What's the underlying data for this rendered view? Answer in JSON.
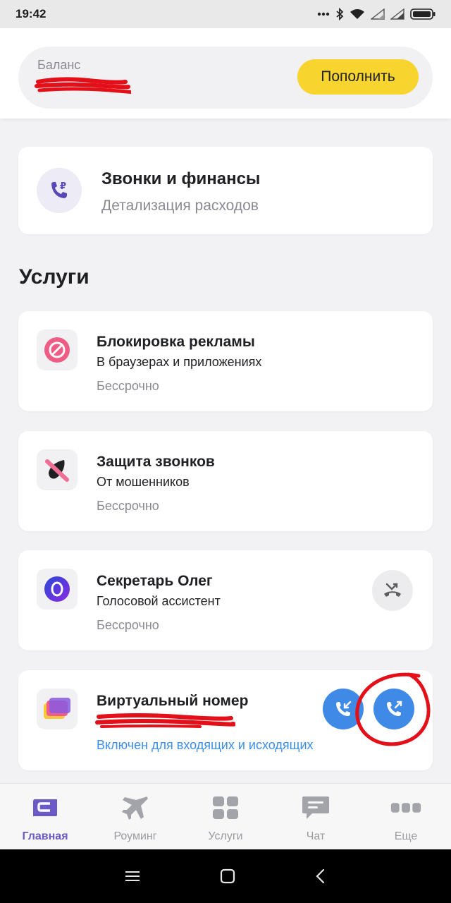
{
  "status_bar": {
    "time": "19:42",
    "icons": [
      "more-dots-icon",
      "bluetooth-icon",
      "wifi-icon",
      "signal-icon",
      "signal-icon",
      "battery-icon"
    ]
  },
  "balance": {
    "label": "Баланс",
    "value": "",
    "topup_label": "Пополнить"
  },
  "finance": {
    "title": "Звонки и финансы",
    "subtitle": "Детализация расходов",
    "icon": "phone-ruble-icon"
  },
  "services_section": {
    "title": "Услуги"
  },
  "services": [
    {
      "title": "Блокировка рекламы",
      "subtitle": "В браузерах и приложениях",
      "status": "Бессрочно",
      "icon": "no-ads-icon"
    },
    {
      "title": "Защита звонков",
      "subtitle": "От мошенников",
      "status": "Бессрочно",
      "icon": "call-protection-icon"
    },
    {
      "title": "Секретарь Олег",
      "subtitle": "Голосовой ассистент",
      "status": "Бессрочно",
      "icon": "oleg-assistant-icon"
    },
    {
      "title": "Виртуальный номер",
      "subtitle": "",
      "status": "Включен для входящих и исходящих",
      "icon": "virtual-number-icon"
    }
  ],
  "bottom_nav": [
    {
      "label": "Главная",
      "icon": "home-icon",
      "active": true
    },
    {
      "label": "Роуминг",
      "icon": "plane-icon",
      "active": false
    },
    {
      "label": "Услуги",
      "icon": "grid-icon",
      "active": false
    },
    {
      "label": "Чат",
      "icon": "chat-icon",
      "active": false
    },
    {
      "label": "Еще",
      "icon": "more-icon",
      "active": false
    }
  ],
  "colors": {
    "accent_yellow": "#f7d42e",
    "brand_purple": "#6c5ac7",
    "link_blue": "#3d8ee6",
    "call_blue": "#3f8ae6",
    "annotation_red": "#e3101a"
  }
}
